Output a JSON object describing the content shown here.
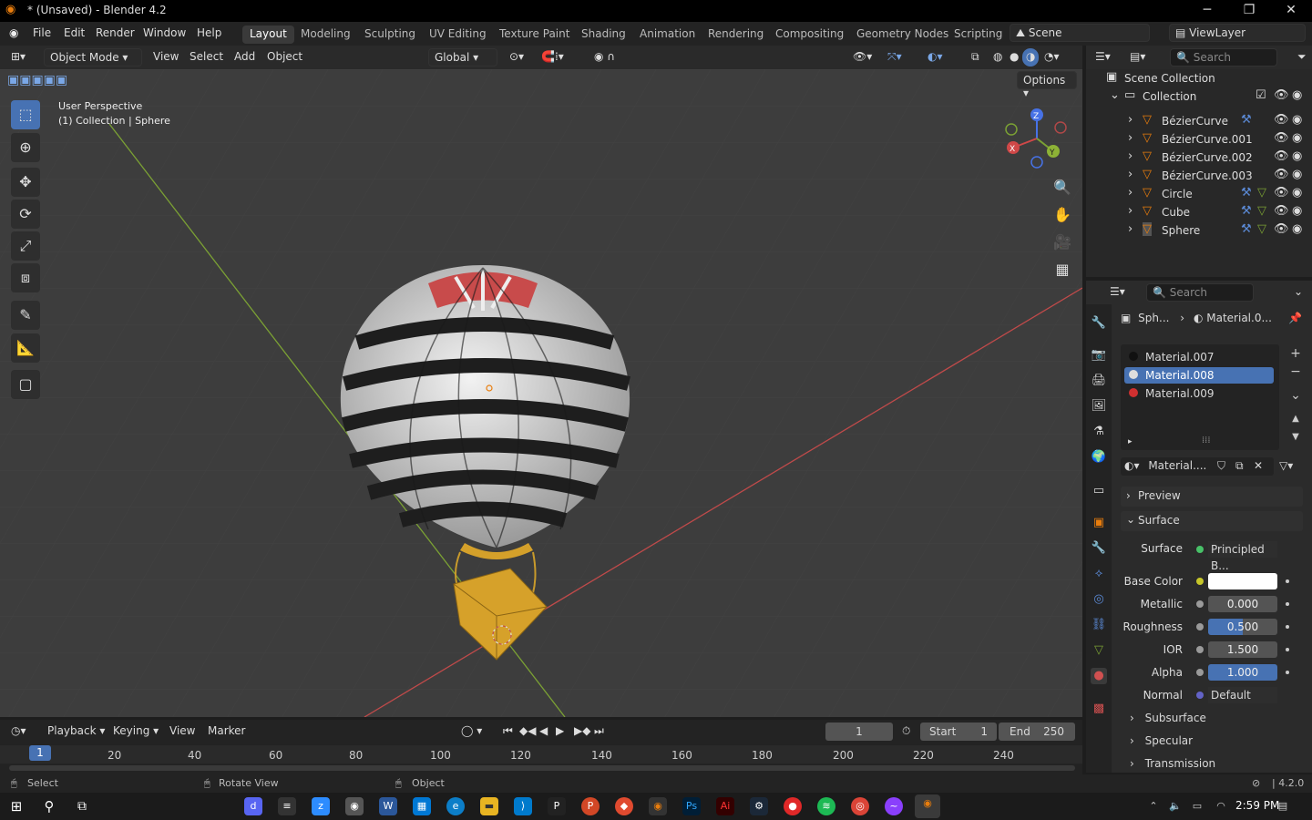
{
  "window": {
    "title": "* (Unsaved) - Blender 4.2",
    "minimize": "─",
    "maximize": "❐",
    "close": "✕"
  },
  "menu": [
    "File",
    "Edit",
    "Render",
    "Window",
    "Help"
  ],
  "workspaces": [
    "Layout",
    "Modeling",
    "Sculpting",
    "UV Editing",
    "Texture Paint",
    "Shading",
    "Animation",
    "Rendering",
    "Compositing",
    "Geometry Nodes",
    "Scripting"
  ],
  "scene": "Scene",
  "view_layer": "ViewLayer",
  "viewport_header": {
    "mode": "Object Mode",
    "menus": [
      "View",
      "Select",
      "Add",
      "Object"
    ],
    "orientation": "Global",
    "options": "Options"
  },
  "viewport_info": {
    "line1": "User Perspective",
    "line2": "(1) Collection | Sphere"
  },
  "gizmo": {
    "x": "X",
    "y": "Y",
    "z": "Z"
  },
  "outliner": {
    "search_placeholder": "Search",
    "root": "Scene Collection",
    "collection": "Collection",
    "items": [
      "BézierCurve",
      "BézierCurve.001",
      "BézierCurve.002",
      "BézierCurve.003",
      "Circle",
      "Cube",
      "Sphere"
    ]
  },
  "properties": {
    "search_placeholder": "Search",
    "breadcrumb_object": "Sph...",
    "breadcrumb_material": "Material.0...",
    "materials": [
      "Material.007",
      "Material.008",
      "Material.009"
    ],
    "selected_material": "Material.008",
    "material_name": "Material....",
    "panels": {
      "preview": "Preview",
      "surface": "Surface",
      "subsurface": "Subsurface",
      "specular": "Specular",
      "transmission": "Transmission"
    },
    "surface_label": "Surface",
    "surface_value": "Principled B...",
    "base_color_label": "Base Color",
    "base_color": "#ffffff",
    "metallic_label": "Metallic",
    "metallic": "0.000",
    "roughness_label": "Roughness",
    "roughness": "0.500",
    "ior_label": "IOR",
    "ior": "1.500",
    "alpha_label": "Alpha",
    "alpha": "1.000",
    "normal_label": "Normal",
    "normal": "Default"
  },
  "timeline": {
    "menus": [
      "Playback",
      "Keying",
      "View",
      "Marker"
    ],
    "current_frame": "1",
    "start_label": "Start",
    "start": "1",
    "end_label": "End",
    "end": "250",
    "ruler": [
      "1",
      "20",
      "40",
      "60",
      "80",
      "100",
      "120",
      "140",
      "160",
      "180",
      "200",
      "220",
      "240"
    ]
  },
  "statusbar": {
    "select": "Select",
    "rotate": "Rotate View",
    "object": "Object",
    "version": "4.2.0"
  },
  "taskbar": {
    "time": "2:59 PM"
  },
  "colors": {
    "accent": "#4772b3",
    "orange": "#e87d0d",
    "red_axis": "#c04a4a",
    "green_axis": "#7ba134"
  }
}
